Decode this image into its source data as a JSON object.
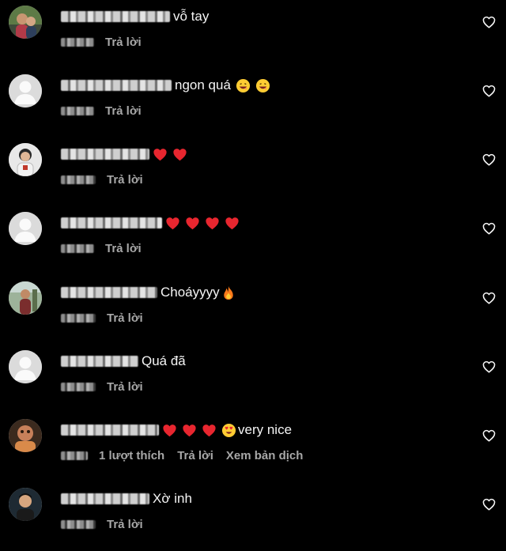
{
  "reply_label": "Trả lời",
  "comments": [
    {
      "text": "vỗ tay",
      "reactions": [],
      "extra_text": "",
      "likes_label": "",
      "translate_label": "",
      "avatar": "person"
    },
    {
      "text": "ngon quá",
      "reactions": [
        "grin-emoji",
        "grin-emoji"
      ],
      "extra_text": "",
      "likes_label": "",
      "translate_label": "",
      "avatar": "default"
    },
    {
      "text": "",
      "reactions": [
        "red-heart",
        "red-heart"
      ],
      "extra_text": "",
      "likes_label": "",
      "translate_label": "",
      "avatar": "person"
    },
    {
      "text": "",
      "reactions": [
        "red-heart",
        "red-heart",
        "red-heart",
        "red-heart"
      ],
      "extra_text": "",
      "likes_label": "",
      "translate_label": "",
      "avatar": "default"
    },
    {
      "text": "Choáyyyy",
      "reactions": [
        "fire"
      ],
      "extra_text": "",
      "likes_label": "",
      "translate_label": "",
      "avatar": "person"
    },
    {
      "text": "Quá đã",
      "reactions": [],
      "extra_text": "",
      "likes_label": "",
      "translate_label": "",
      "avatar": "default"
    },
    {
      "text": "",
      "reactions": [
        "red-heart",
        "red-heart",
        "red-heart",
        "heart-eyes"
      ],
      "extra_text": "very nice",
      "likes_label": "1 lượt thích",
      "translate_label": "Xem bản dịch",
      "avatar": "person"
    },
    {
      "text": "Xờ inh",
      "reactions": [],
      "extra_text": "",
      "likes_label": "",
      "translate_label": "",
      "avatar": "person"
    }
  ]
}
